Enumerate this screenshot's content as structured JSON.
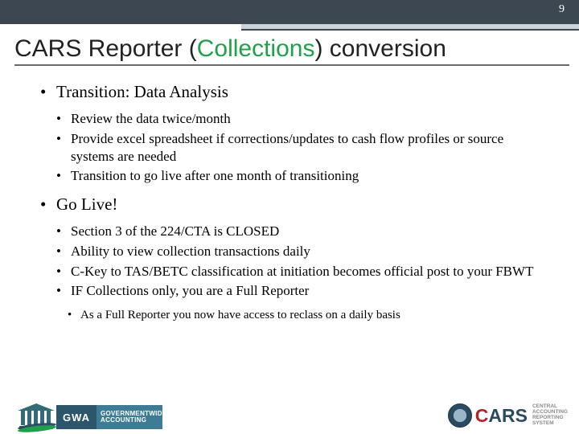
{
  "page_number": "9",
  "title": {
    "prefix": "CARS Reporter (",
    "highlight": "Collections",
    "suffix": ") conversion"
  },
  "sections": [
    {
      "heading": "Transition: Data Analysis",
      "items": [
        "Review the data twice/month",
        "Provide excel spreadsheet if corrections/updates to cash flow profiles or source systems are needed",
        "Transition to go live after one month of transitioning"
      ]
    },
    {
      "heading": "Go Live!",
      "items": [
        "Section 3 of the 224/CTA is CLOSED",
        "Ability to view collection transactions daily",
        "C-Key  to TAS/BETC classification at initiation becomes official post to your FBWT",
        "IF Collections only, you are a Full Reporter"
      ],
      "sub": "As a Full Reporter you now have access to reclass on a daily basis"
    }
  ],
  "footer": {
    "gwa_abbrev": "GWA",
    "gwa_line1": "GOVERNMENTWIDE",
    "gwa_line2": "ACCOUNTING",
    "cars": {
      "c": "C",
      "a": "A",
      "r": "R",
      "s": "S"
    },
    "cars_sub1": "CENTRAL",
    "cars_sub2": "ACCOUNTING",
    "cars_sub3": "REPORTING",
    "cars_sub4": "SYSTEM"
  }
}
